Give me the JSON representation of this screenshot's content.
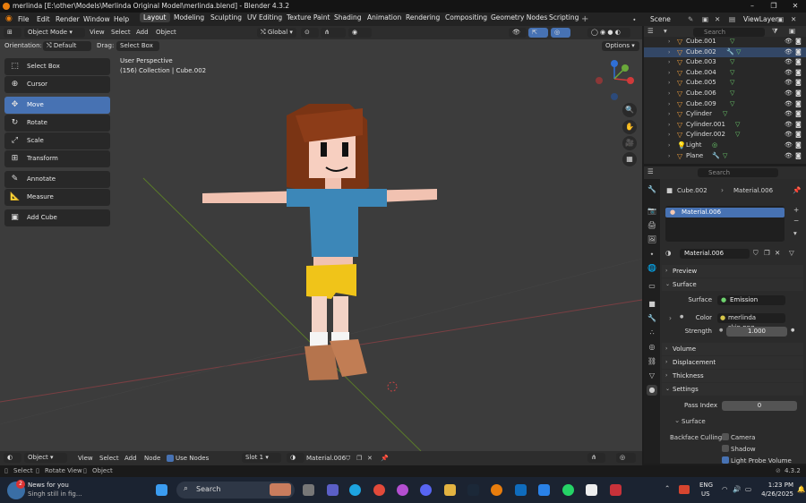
{
  "window": {
    "title": "merlinda [E:\\other\\Models\\Merlinda Original Model\\merlinda.blend] - Blender 4.3.2"
  },
  "menu": [
    "File",
    "Edit",
    "Render",
    "Window",
    "Help"
  ],
  "workspaces": [
    "Layout",
    "Modeling",
    "Sculpting",
    "UV Editing",
    "Texture Paint",
    "Shading",
    "Animation",
    "Rendering",
    "Compositing",
    "Geometry Nodes",
    "Scripting"
  ],
  "active_workspace": "Layout",
  "scene": {
    "label": "Scene",
    "view_layer": "ViewLayer"
  },
  "viewport_header": {
    "mode": "Object Mode",
    "view": "View",
    "select": "Select",
    "add": "Add",
    "object": "Object",
    "orientation_label": "Orientation:",
    "orientation_value": "Default",
    "drag_label": "Drag:",
    "drag_value": "Select Box",
    "transform": "Global",
    "options": "Options"
  },
  "viewport_info": {
    "line1": "User Perspective",
    "line2": "(156) Collection | Cube.002"
  },
  "toolbar": [
    "Select Box",
    "Cursor",
    "Move",
    "Rotate",
    "Scale",
    "Transform",
    "Annotate",
    "Measure",
    "Add Cube"
  ],
  "active_tool": "Move",
  "outliner": {
    "search_placeholder": "Search",
    "items": [
      "Cube.001",
      "Cube.002",
      "Cube.003",
      "Cube.004",
      "Cube.005",
      "Cube.006",
      "Cube.009",
      "Cylinder",
      "Cylinder.001",
      "Cylinder.002",
      "Light",
      "Plane"
    ]
  },
  "properties": {
    "search_placeholder": "Search",
    "breadcrumb_object": "Cube.002",
    "breadcrumb_material": "Material.006",
    "slot": "Material.006",
    "material_name": "Material.006",
    "preview": "Preview",
    "surface_panel": "Surface",
    "surface_label": "Surface",
    "surface_value": "Emission",
    "color_label": "Color",
    "color_value": "merlinda skin.png...",
    "strength_label": "Strength",
    "strength_value": "1.000",
    "volume": "Volume",
    "displacement": "Displacement",
    "thickness": "Thickness",
    "settings": "Settings",
    "pass_index_label": "Pass Index",
    "pass_index_value": "0",
    "surface_sub": "Surface",
    "backface_label": "Backface Culling",
    "camera": "Camera",
    "shadow": "Shadow",
    "light_probe": "Light Probe Volume"
  },
  "node_header": {
    "object": "Object",
    "view": "View",
    "select": "Select",
    "add": "Add",
    "node": "Node",
    "use_nodes": "Use Nodes",
    "slot": "Slot 1",
    "material": "Material.006"
  },
  "statusbar": {
    "select": "Select",
    "rotate": "Rotate View",
    "object": "Object",
    "version": "4.3.2"
  },
  "taskbar": {
    "news_title": "News for you",
    "news_sub": "Singh still in fig...",
    "news_badge": "2",
    "search": "Search",
    "lang1": "ENG",
    "lang2": "US",
    "time": "1:23 PM",
    "date": "4/26/2025"
  },
  "colors": {
    "accent": "#4772b3",
    "blender_orange": "#e87d0d",
    "viewport_bg": "#3c3c3c"
  }
}
